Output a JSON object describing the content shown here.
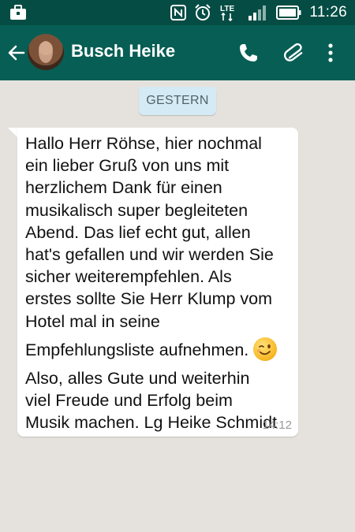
{
  "status_bar": {
    "time": "11:26",
    "network": "LTE"
  },
  "header": {
    "contact_name": "Busch Heike"
  },
  "chat": {
    "date_separator": "GESTERN",
    "message": {
      "lines": [
        "Hallo Herr Röhse, hier nochmal",
        "ein lieber Gruß von uns mit",
        "herzlichem Dank für einen",
        "musikalisch super begleiteten",
        "Abend. Das lief echt gut, allen",
        "hat's gefallen und wir werden Sie",
        "sicher weiterempfehlen. Als",
        "erstes sollte Sie Herr Klump vom",
        "Hotel mal in seine",
        "Empfehlungsliste aufnehmen.",
        "Also,  alles Gute und weiterhin",
        "viel Freude und Erfolg beim",
        "Musik machen. Lg Heike Schmidt"
      ],
      "emoji": "wink-emoji",
      "time": "14:12"
    }
  },
  "colors": {
    "status_bar": "#054d44",
    "app_bar": "#075e54",
    "chat_background": "#e5e2dd",
    "date_chip": "#d4eaf4",
    "bubble": "#ffffff"
  }
}
